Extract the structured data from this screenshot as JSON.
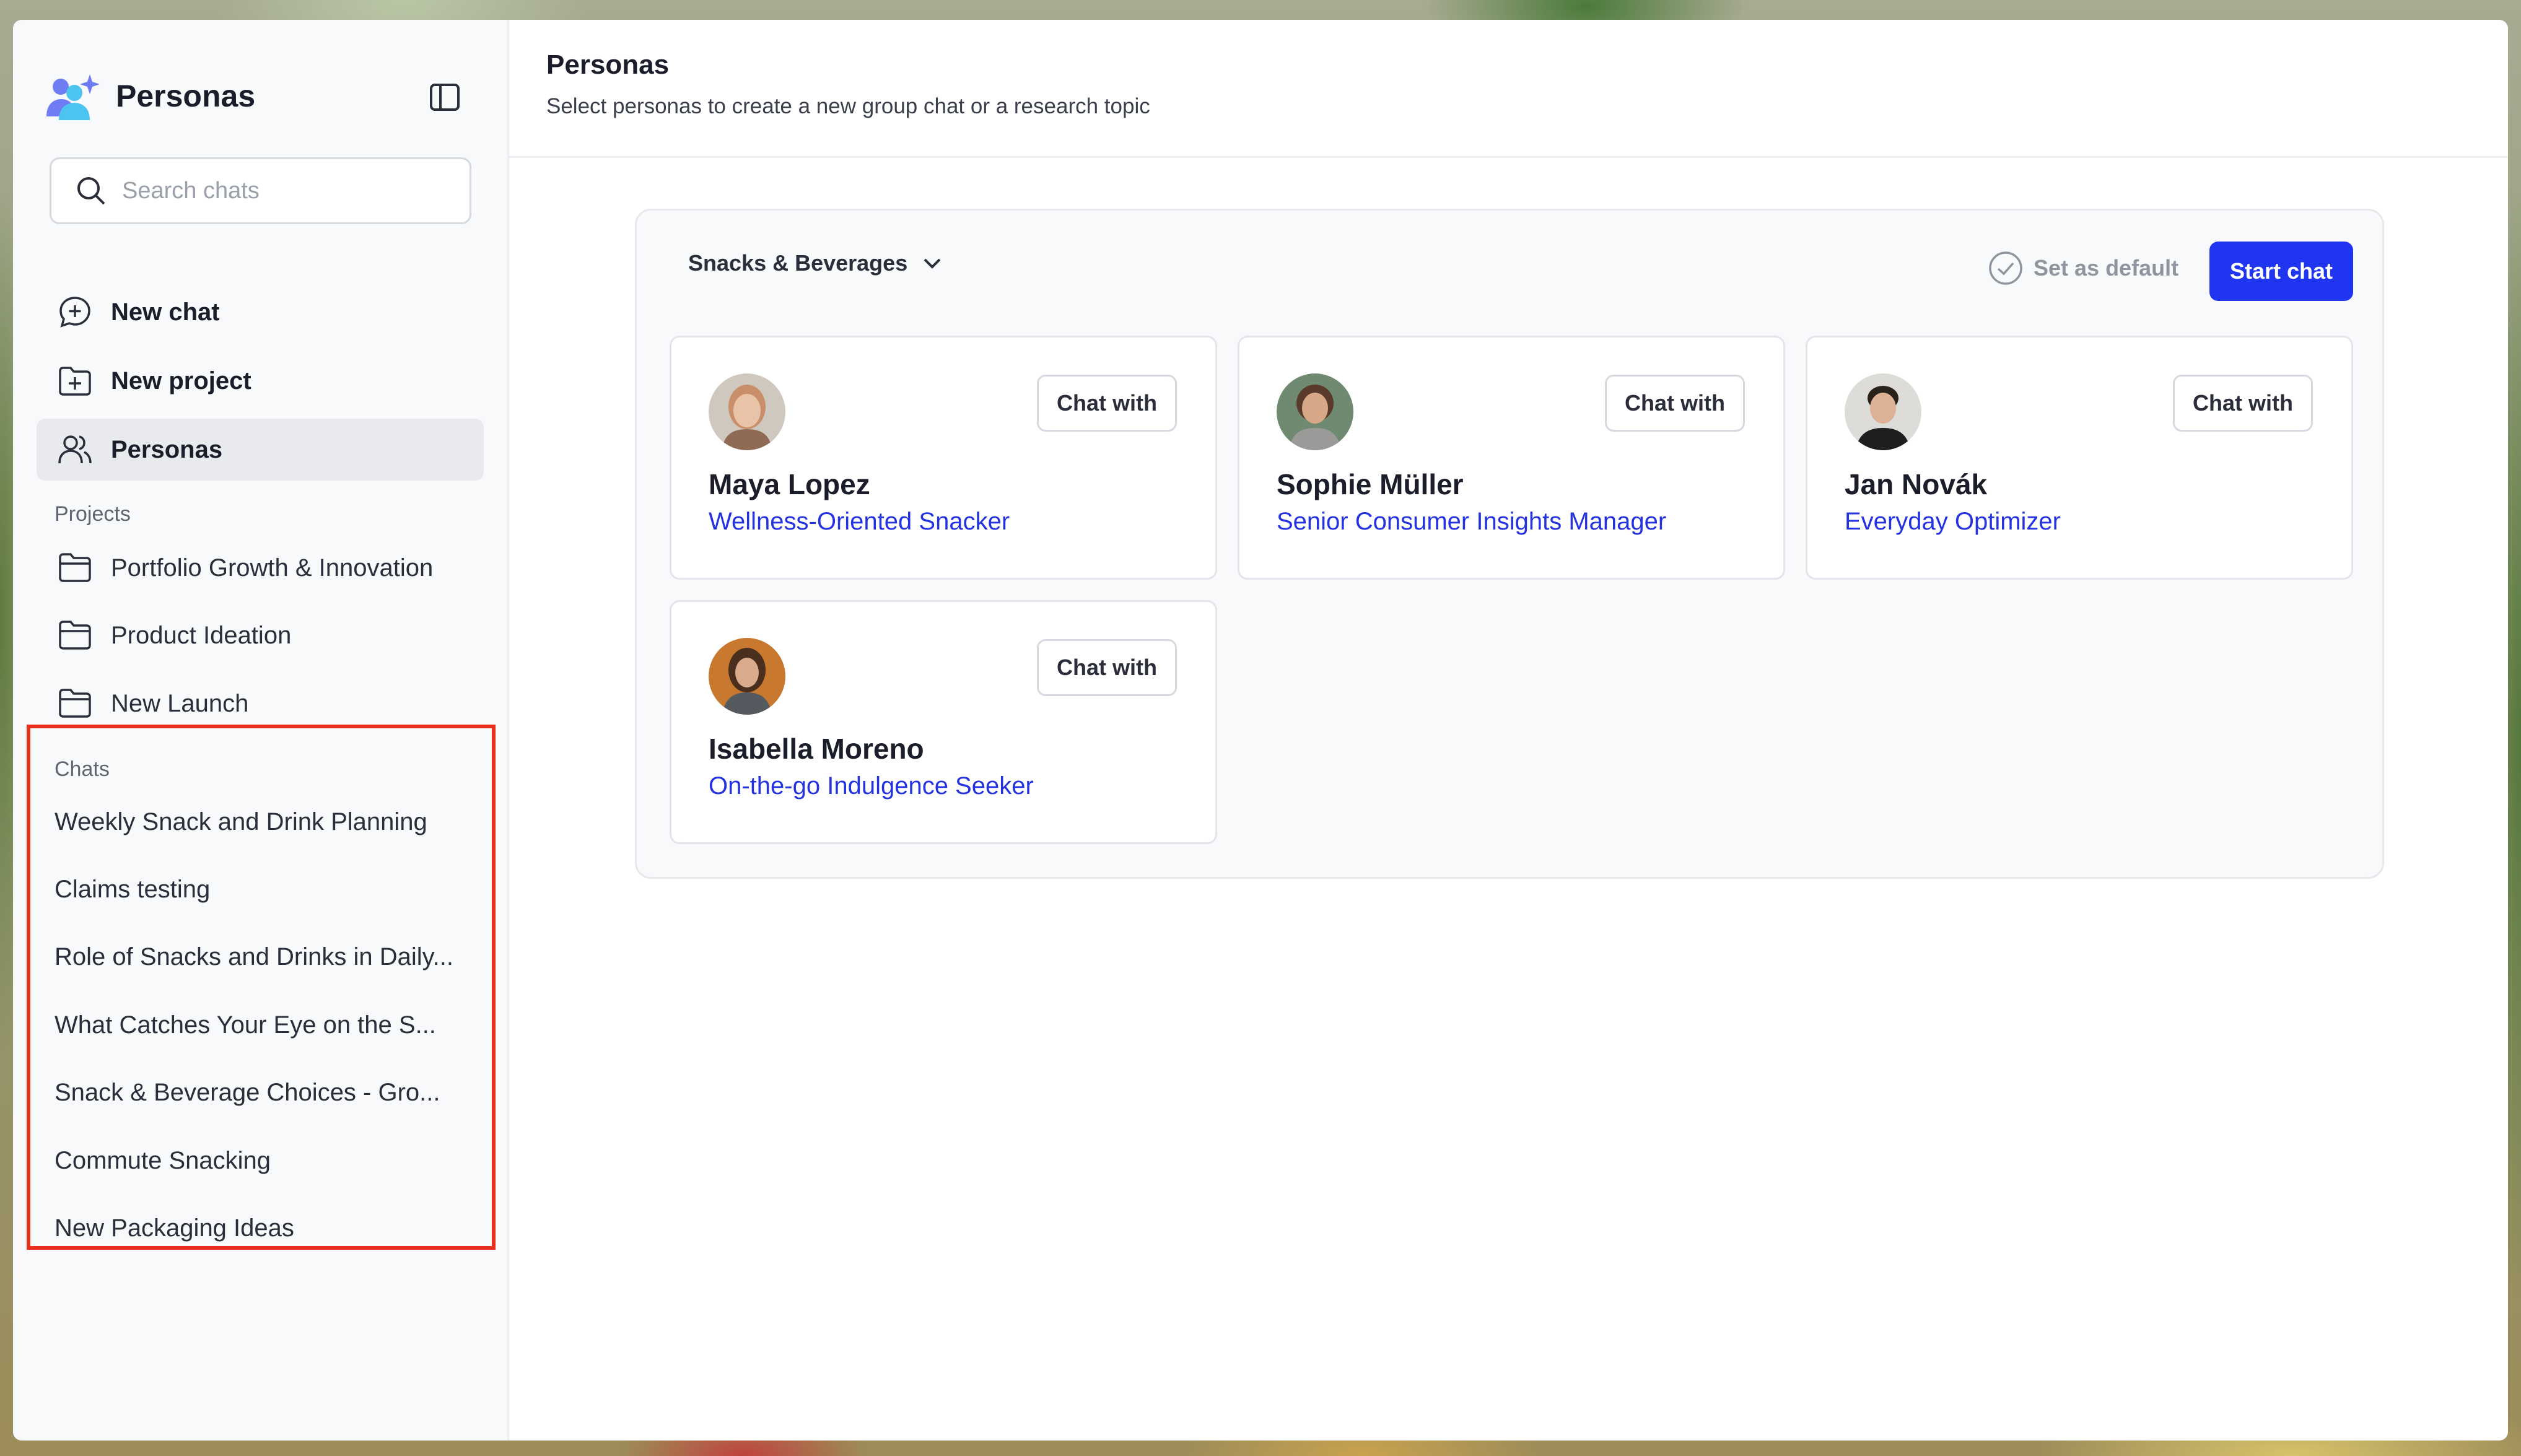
{
  "sidebar": {
    "brand_title": "Personas",
    "search_placeholder": "Search chats",
    "nav": [
      {
        "label": "New chat",
        "icon": "chat-plus-icon"
      },
      {
        "label": "New project",
        "icon": "folder-plus-icon"
      },
      {
        "label": "Personas",
        "icon": "users-icon",
        "active": true
      }
    ],
    "projects_label": "Projects",
    "projects": [
      {
        "label": "Portfolio Growth & Innovation",
        "icon": "folder-icon"
      },
      {
        "label": "Product Ideation",
        "icon": "folder-icon"
      },
      {
        "label": "New Launch",
        "icon": "folder-icon"
      }
    ],
    "chats_label": "Chats",
    "chats": [
      "Weekly Snack and Drink Planning",
      "Claims testing",
      "Role of Snacks and Drinks in Daily...",
      "What Catches Your Eye on the S...",
      "Snack & Beverage Choices - Gro...",
      "Commute Snacking",
      "New Packaging Ideas"
    ]
  },
  "header": {
    "title": "Personas",
    "subtitle": "Select personas to create a new group chat or a research topic"
  },
  "toolbar": {
    "category": "Snacks & Beverages",
    "set_default_label": "Set as default",
    "start_chat_label": "Start chat"
  },
  "personas": [
    {
      "name": "Maya Lopez",
      "role": "Wellness-Oriented Snacker",
      "chat_label": "Chat with"
    },
    {
      "name": "Sophie Müller",
      "role": "Senior Consumer Insights Manager",
      "chat_label": "Chat with"
    },
    {
      "name": "Jan Novák",
      "role": "Everyday Optimizer",
      "chat_label": "Chat with"
    },
    {
      "name": "Isabella Moreno",
      "role": "On-the-go Indulgence Seeker",
      "chat_label": "Chat with"
    }
  ],
  "colors": {
    "accent": "#1f35f0",
    "persona_role": "#2433df",
    "highlight_box": "#e8311d"
  }
}
